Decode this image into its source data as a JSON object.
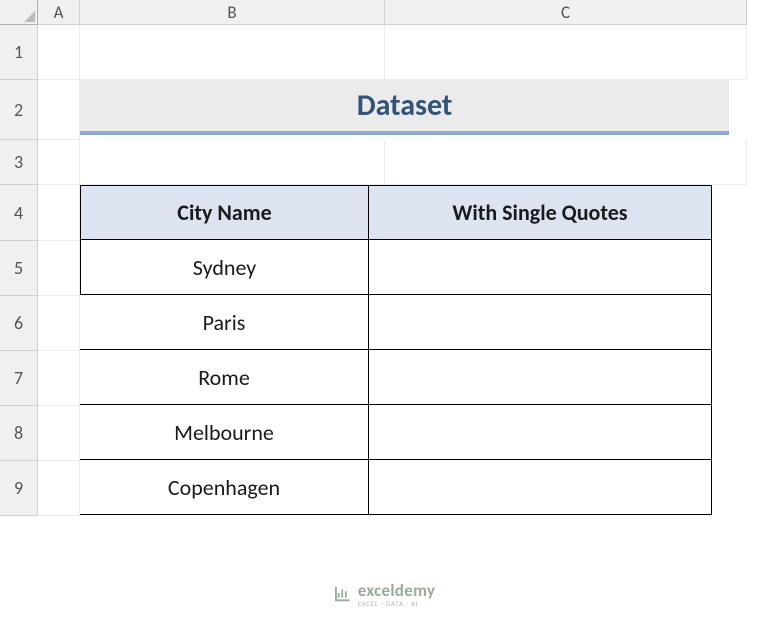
{
  "columns": [
    "A",
    "B",
    "C"
  ],
  "rows": [
    "1",
    "2",
    "3",
    "4",
    "5",
    "6",
    "7",
    "8",
    "9"
  ],
  "title": "Dataset",
  "table": {
    "headers": [
      "City Name",
      "With Single Quotes"
    ],
    "rows": [
      {
        "city": "Sydney",
        "quoted": ""
      },
      {
        "city": "Paris",
        "quoted": ""
      },
      {
        "city": "Rome",
        "quoted": ""
      },
      {
        "city": "Melbourne",
        "quoted": ""
      },
      {
        "city": "Copenhagen",
        "quoted": ""
      }
    ]
  },
  "watermark": {
    "main": "exceldemy",
    "sub": "EXCEL · DATA · BI"
  }
}
